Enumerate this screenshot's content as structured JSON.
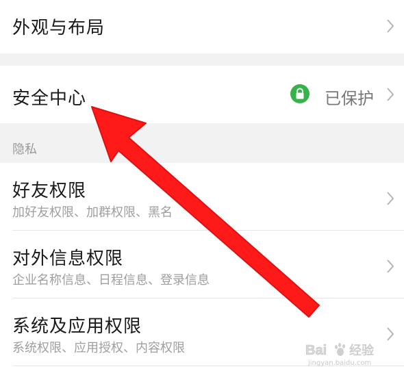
{
  "rows": {
    "appearance": {
      "title": "外观与布局"
    },
    "security": {
      "title": "安全中心",
      "status": "已保护"
    },
    "privacy_section": {
      "label": "隐私"
    },
    "friend_perms": {
      "title": "好友权限",
      "subtitle": "加好友权限、加群权限、黑名"
    },
    "external_info": {
      "title": "对外信息权限",
      "subtitle": "企业名称信息、日程信息、登录信息"
    },
    "system_perms": {
      "title": "系统及应用权限",
      "subtitle": "系统权限、应用授权、内容权限"
    }
  },
  "watermark": {
    "brand": "Bai",
    "suffix": "经验",
    "url": "jingyan.baidu.com"
  },
  "colors": {
    "lock_green": "#35b34a",
    "annotation_red": "#ff1a1a",
    "section_bg": "#f2f2f2"
  },
  "icons": {
    "chevron": "chevron-right-icon",
    "lock": "lock-icon",
    "arrow": "annotation-arrow"
  }
}
